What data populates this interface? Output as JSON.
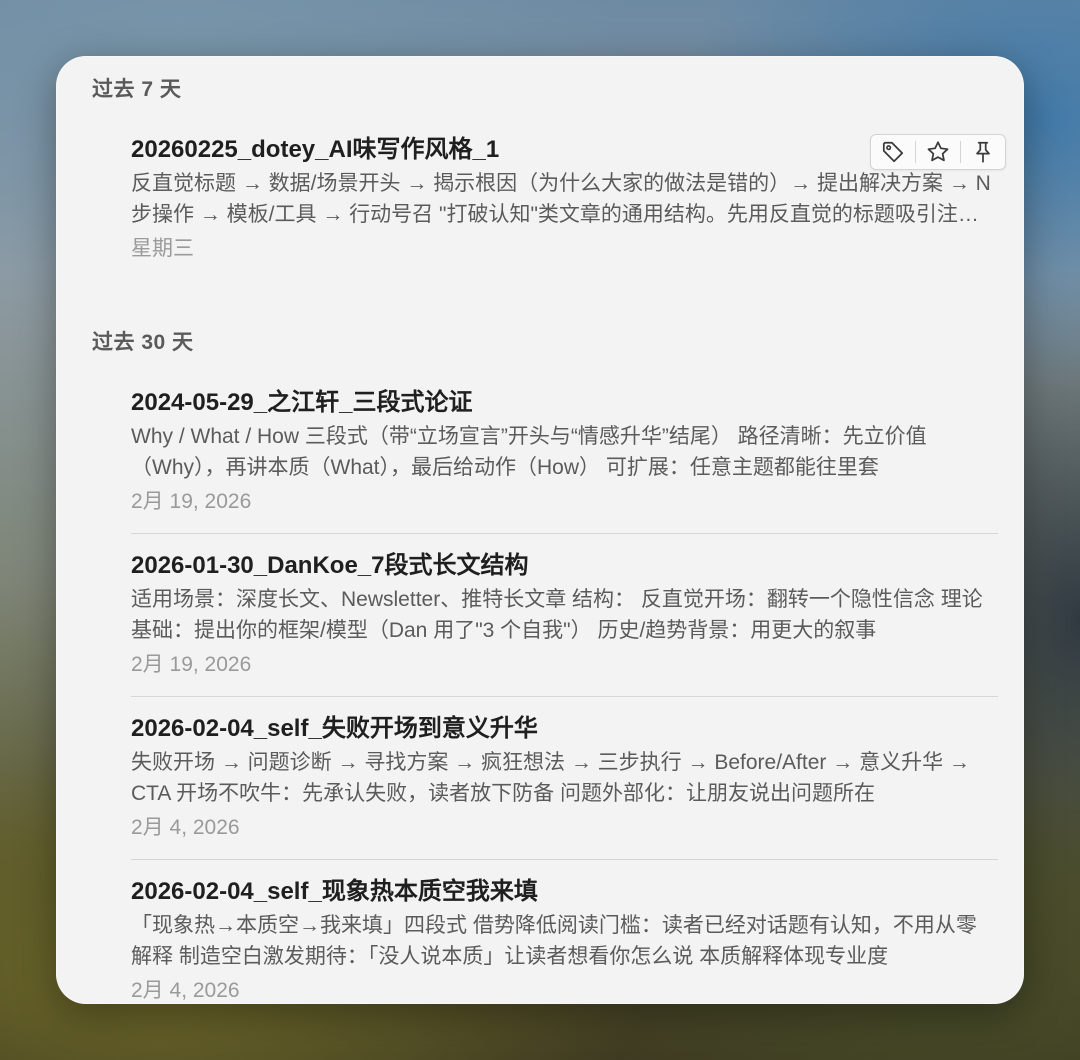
{
  "sections": [
    {
      "header": "过去 7 天",
      "items": [
        {
          "title": "20260225_dotey_AI味写作风格_1",
          "excerpt": "反直觉标题 → 数据/场景开头 → 揭示根因（为什么大家的做法是错的）→ 提出解决方案 → N步操作 → 模板/工具 → 行动号召 \"打破认知\"类文章的通用结构。先用反直觉的标题吸引注意力",
          "date": "星期三"
        }
      ]
    },
    {
      "header": "过去 30 天",
      "items": [
        {
          "title": "2024-05-29_之江轩_三段式论证",
          "excerpt": "Why / What / How 三段式（带“立场宣言”开头与“情感升华”结尾） 路径清晰：先立价值（Why），再讲本质（What），最后给动作（How） 可扩展：任意主题都能往里套",
          "date": "2月 19, 2026"
        },
        {
          "title": "2026-01-30_DanKoe_7段式长文结构",
          "excerpt": "适用场景：深度长文、Newsletter、推特长文章 结构： 反直觉开场：翻转一个隐性信念 理论基础：提出你的框架/模型（Dan 用了\"3 个自我\"） 历史/趋势背景：用更大的叙事",
          "date": "2月 19, 2026"
        },
        {
          "title": "2026-02-04_self_失败开场到意义升华",
          "excerpt": "失败开场 → 问题诊断 → 寻找方案 → 疯狂想法 → 三步执行 → Before/After → 意义升华 → CTA 开场不吹牛：先承认失败，读者放下防备 问题外部化：让朋友说出问题所在",
          "date": "2月 4, 2026"
        },
        {
          "title": "2026-02-04_self_现象热本质空我来填",
          "excerpt": "「现象热→本质空→我来填」四段式 借势降低阅读门槛：读者已经对话题有认知，不用从零解释 制造空白激发期待：「没人说本质」让读者想看你怎么说 本质解释体现专业度",
          "date": "2月 4, 2026"
        }
      ]
    }
  ],
  "actions": {
    "icons": [
      "tag-icon",
      "star-icon",
      "pin-icon"
    ]
  }
}
